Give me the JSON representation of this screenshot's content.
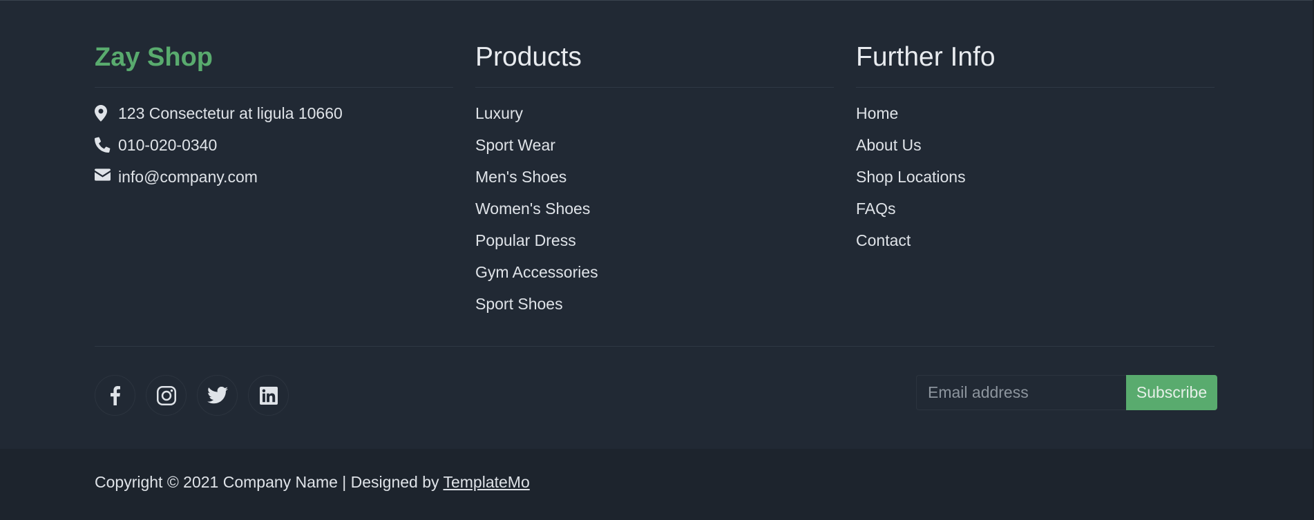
{
  "brand": {
    "name": "Zay Shop",
    "color": "#59ab6e"
  },
  "contact": {
    "address": "123 Consectetur at ligula 10660",
    "phone": "010-020-0340",
    "email": "info@company.com",
    "icons": [
      "map-marker-icon",
      "phone-icon",
      "envelope-icon"
    ]
  },
  "products": {
    "title": "Products",
    "items": [
      "Luxury",
      "Sport Wear",
      "Men's Shoes",
      "Women's Shoes",
      "Popular Dress",
      "Gym Accessories",
      "Sport Shoes"
    ]
  },
  "further_info": {
    "title": "Further Info",
    "items": [
      "Home",
      "About Us",
      "Shop Locations",
      "FAQs",
      "Contact"
    ]
  },
  "social": [
    "facebook-icon",
    "instagram-icon",
    "twitter-icon",
    "linkedin-icon"
  ],
  "subscribe": {
    "placeholder": "Email address",
    "button_label": "Subscribe",
    "button_color": "#59ab6e"
  },
  "copyright": {
    "text": "Copyright © 2021 Company Name | Designed by ",
    "link_label": "TemplateMo"
  }
}
